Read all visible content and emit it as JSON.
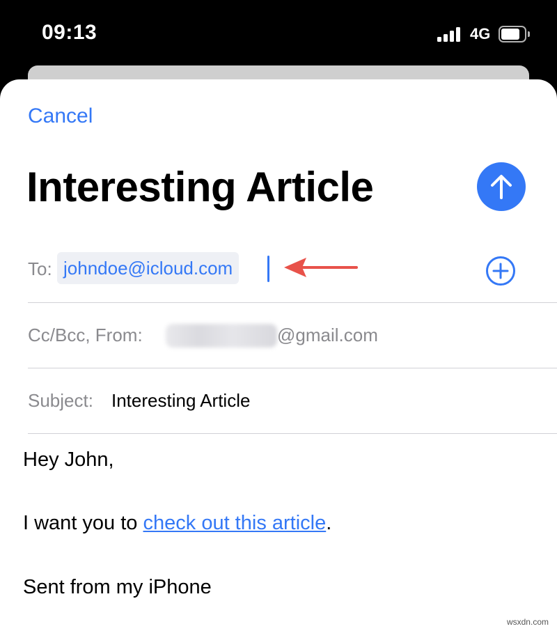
{
  "status_bar": {
    "time": "09:13",
    "network": "4G",
    "icons": [
      "signal-bars-icon",
      "battery-icon"
    ]
  },
  "compose": {
    "cancel_label": "Cancel",
    "title": "Interesting Article",
    "send_icon": "arrow-up-icon",
    "to": {
      "label": "To:",
      "recipient": "johndoe@icloud.com",
      "add_icon": "plus-circle-icon"
    },
    "cc_bcc": {
      "label": "Cc/Bcc, From:",
      "from_domain": "@gmail.com"
    },
    "subject": {
      "label": "Subject:",
      "value": "Interesting Article"
    },
    "body": {
      "greeting": "Hey John,",
      "line_prefix": "I want you to ",
      "link_text": "check out this article",
      "line_suffix": ".",
      "signature": "Sent from my iPhone"
    }
  },
  "watermark": "wsxdn.com",
  "colors": {
    "accent": "#3478f6",
    "annotation_arrow": "#e8524a",
    "secondary_text": "#8a8a8e"
  }
}
